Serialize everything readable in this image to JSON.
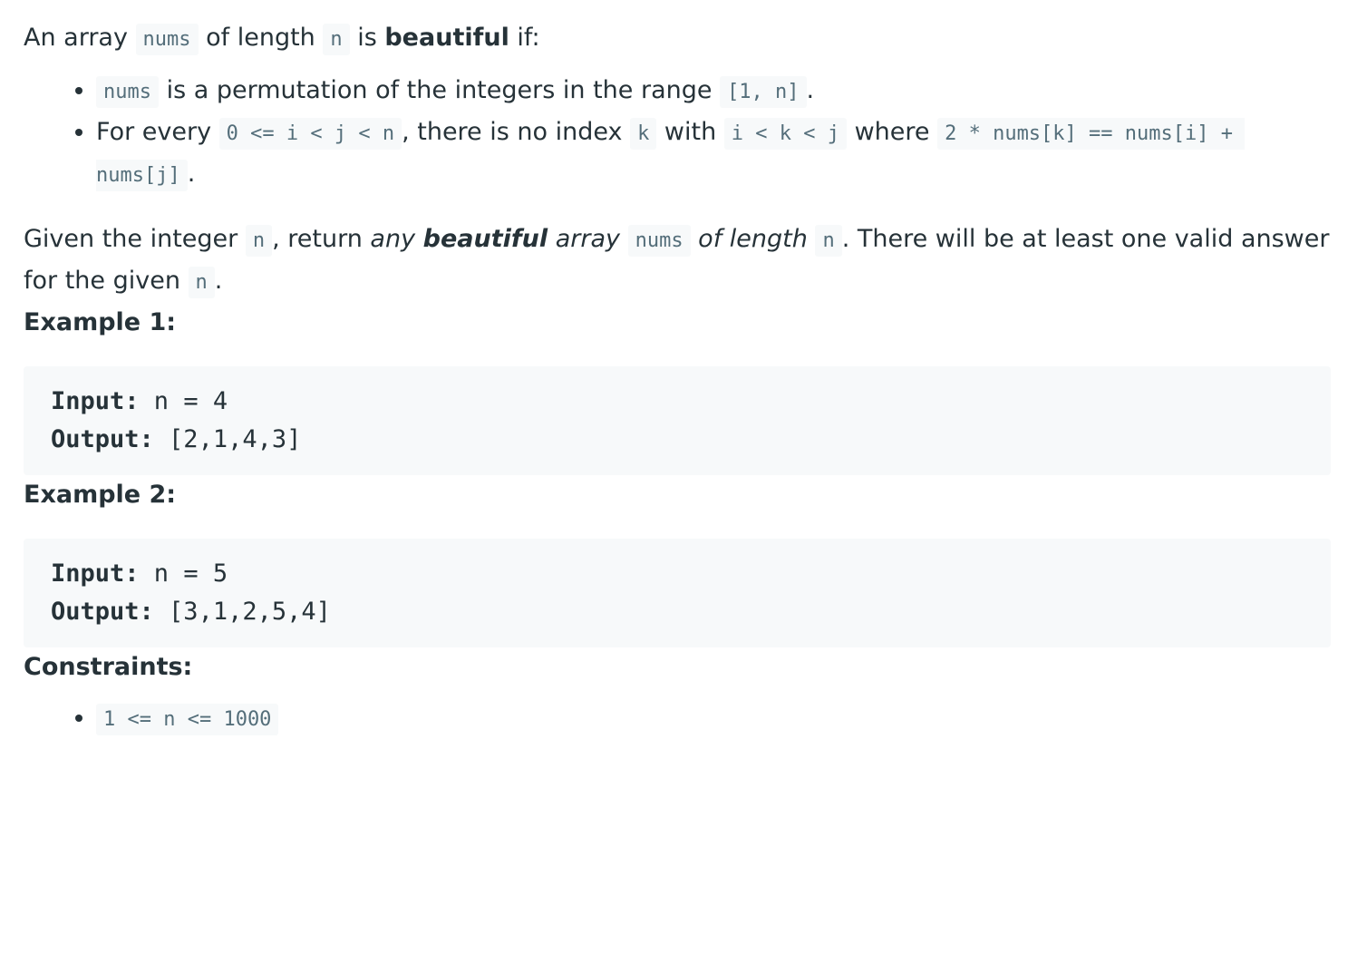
{
  "intro": {
    "t1": "An array ",
    "c1": "nums",
    "t2": " of length ",
    "c2": "n",
    "t3": " is ",
    "b1": "beautiful",
    "t4": " if:"
  },
  "bullet1": {
    "c1": "nums",
    "t1": " is a permutation of the integers in the range ",
    "c2": "[1, n]",
    "t2": "."
  },
  "bullet2": {
    "t1": "For every ",
    "c1": "0 <= i < j < n",
    "t2": ", there is no index ",
    "c2": "k",
    "t3": " with ",
    "c3": "i < k < j",
    "t4": " where ",
    "c4": "2 * nums[k] == nums[i] + nums[j]",
    "t5": "."
  },
  "given": {
    "t1": "Given the integer ",
    "c1": "n",
    "t2": ", return ",
    "i1": "any",
    "b1": "beautiful",
    "i2": "array",
    "c2": "nums",
    "i3": "of length",
    "c3": "n",
    "t3": ". There will be at least one valid answer for the given ",
    "c4": "n",
    "t4": "."
  },
  "example1": {
    "title": "Example 1:",
    "input_label": "Input:",
    "input_value": " n = 4",
    "output_label": "Output:",
    "output_value": " [2,1,4,3]"
  },
  "example2": {
    "title": "Example 2:",
    "input_label": "Input:",
    "input_value": " n = 5",
    "output_label": "Output:",
    "output_value": " [3,1,2,5,4]"
  },
  "constraints": {
    "title": "Constraints:",
    "items": [
      "1 <= n <= 1000"
    ]
  }
}
